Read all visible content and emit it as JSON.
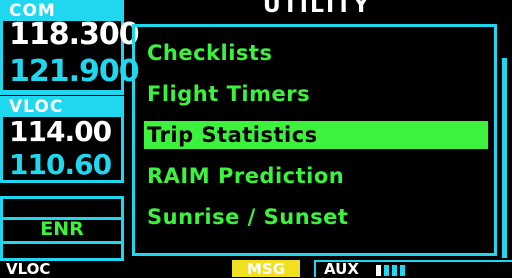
{
  "com": {
    "label": "COM",
    "active": "118.300",
    "standby": "121.900"
  },
  "vloc": {
    "label": "VLOC",
    "active": "114.00",
    "standby": "110.60"
  },
  "mode": {
    "label": "ENR"
  },
  "utility": {
    "title": "UTILITY",
    "items": [
      {
        "label": "Checklists",
        "selected": false
      },
      {
        "label": "Flight Timers",
        "selected": false
      },
      {
        "label": "Trip Statistics",
        "selected": true
      },
      {
        "label": "RAIM Prediction",
        "selected": false
      },
      {
        "label": "Sunrise / Sunset",
        "selected": false
      }
    ]
  },
  "status_bar": {
    "nav_source": "VLOC",
    "msg": "MSG",
    "page_group": "AUX",
    "page_count": 4,
    "active_page": 1
  },
  "colors": {
    "accent": "#1fd8f0",
    "highlight": "#3cf23c",
    "msg": "#f0e020"
  }
}
